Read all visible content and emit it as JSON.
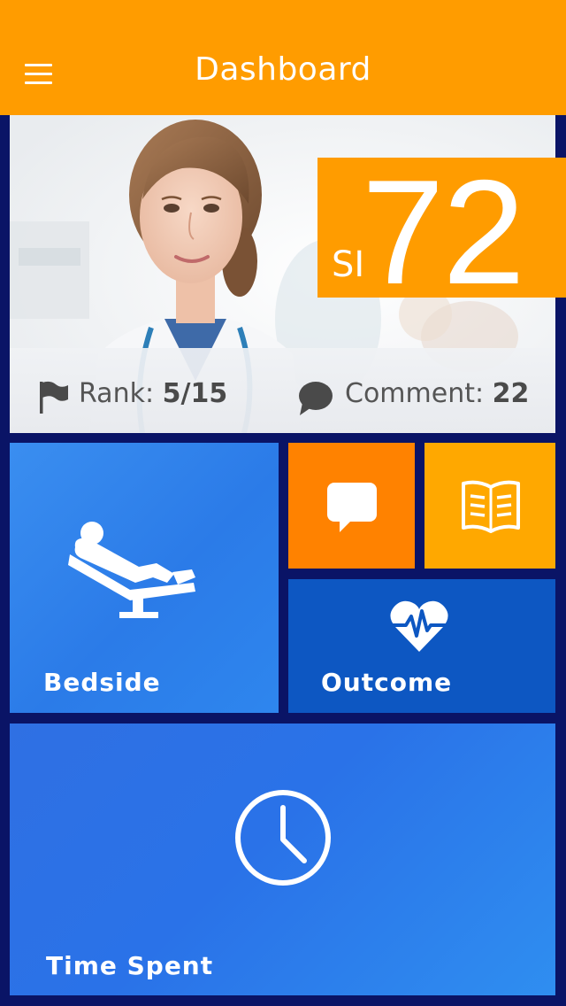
{
  "header": {
    "title": "Dashboard",
    "menu_icon": "hamburger-menu-icon",
    "background": "#ff9c00"
  },
  "hero": {
    "photo": "doctor-portrait",
    "score": {
      "prefix": "SI",
      "value": "72"
    },
    "rank": {
      "icon": "flag-icon",
      "label": "Rank:",
      "value": "5/15"
    },
    "comment": {
      "icon": "speech-bubble-icon",
      "label": "Comment:",
      "value": "22"
    }
  },
  "tiles": {
    "bedside": {
      "label": "Bedside",
      "icon": "patient-bed-icon",
      "color": "#3a8ef0"
    },
    "chat": {
      "icon": "chat-bubble-icon",
      "color": "#ff8200"
    },
    "book": {
      "icon": "open-book-icon",
      "color": "#ffa800"
    },
    "outcome": {
      "label": "Outcome",
      "icon": "heart-pulse-icon",
      "color": "#0d57c2"
    },
    "time_spent": {
      "label": "Time Spent",
      "icon": "clock-icon",
      "color": "#2f70e3"
    }
  },
  "colors": {
    "background": "#0a1466",
    "accent": "#ff9c00"
  }
}
